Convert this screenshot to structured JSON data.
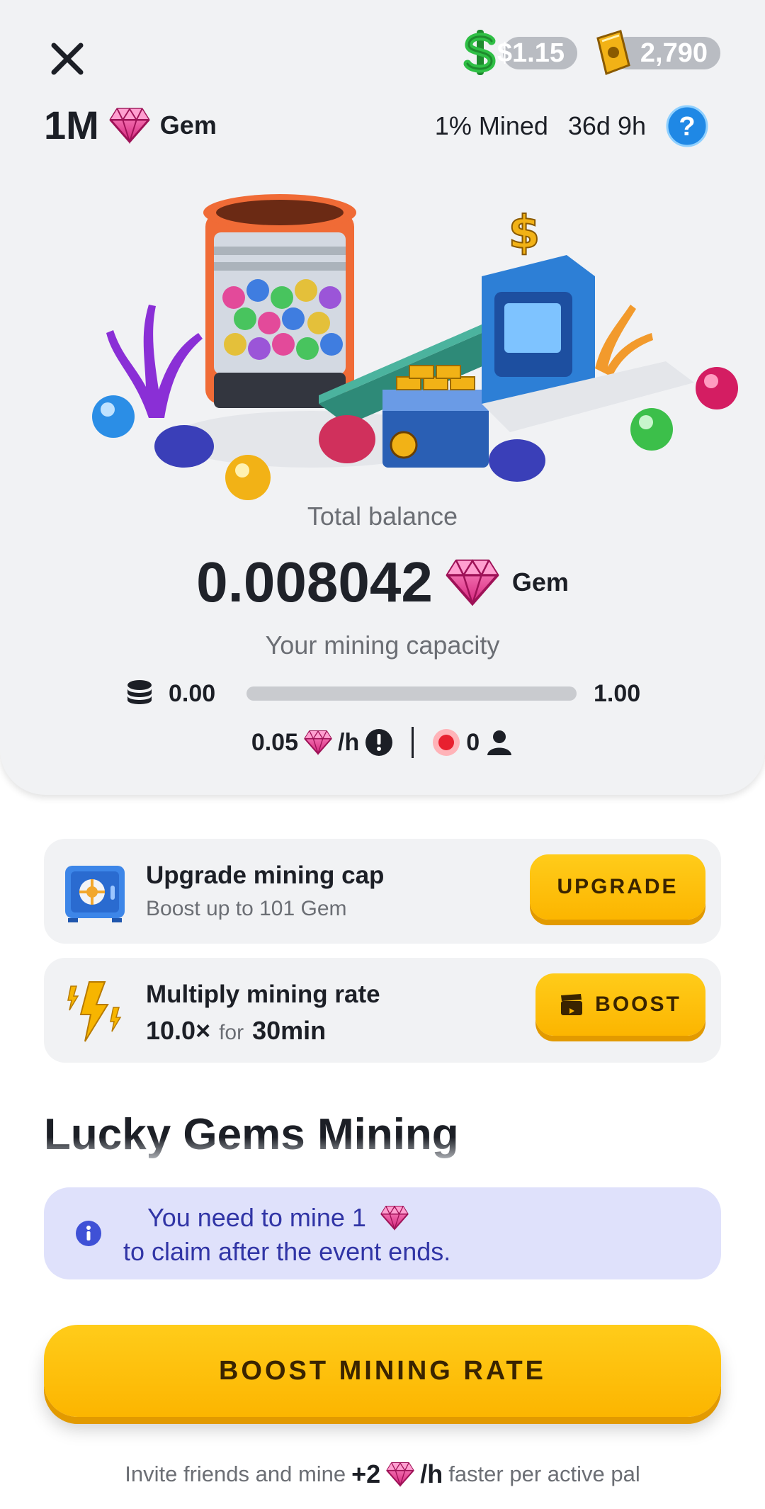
{
  "header": {
    "cash_balance": "$1.15",
    "tickets_balance": "2,790"
  },
  "event": {
    "pool_amount": "1M",
    "currency": "Gem",
    "mined_percent": "1% Mined",
    "time_left": "36d 9h"
  },
  "balance": {
    "label": "Total balance",
    "value": "0.008042",
    "currency": "Gem"
  },
  "capacity": {
    "label": "Your mining capacity",
    "min": "0.00",
    "max": "1.00",
    "fill_fraction": 0.0
  },
  "rate": {
    "value": "0.05",
    "unit": "/h",
    "active_pals": "0"
  },
  "upgrade_card": {
    "title": "Upgrade mining cap",
    "subtitle": "Boost up to 101 Gem",
    "button": "UPGRADE"
  },
  "boost_card": {
    "title": "Multiply mining rate",
    "multiplier": "10.0×",
    "for_text": "for",
    "duration": "30min",
    "button": "BOOST"
  },
  "section": {
    "title": "Lucky Gems Mining"
  },
  "info": {
    "line1": "You need to mine 1",
    "line2": "to claim after the event ends."
  },
  "main_button": "BOOST MINING RATE",
  "invite": {
    "prefix": "Invite friends and mine",
    "bonus": "+2",
    "unit": "/h",
    "suffix": "faster per active pal"
  },
  "colors": {
    "accent_yellow": "#fcb500",
    "info_bg": "#dfe1fb",
    "info_text": "#3135a6",
    "gem_pink": "#e8348f"
  }
}
